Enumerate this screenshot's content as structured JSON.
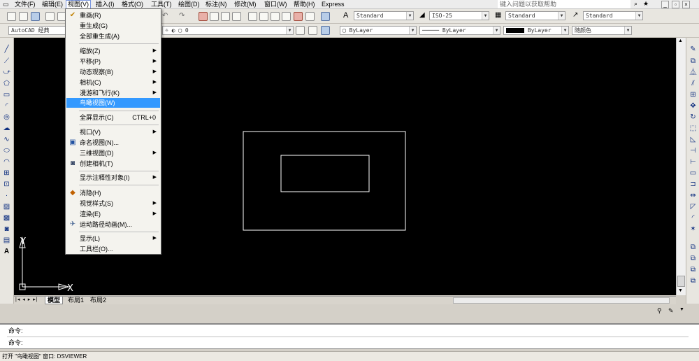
{
  "menubar": {
    "items": [
      "文件(F)",
      "编辑(E)",
      "视图(V)",
      "插入(I)",
      "格式(O)",
      "工具(T)",
      "绘图(D)",
      "标注(N)",
      "修改(M)",
      "窗口(W)",
      "帮助(H)",
      "Express"
    ],
    "help_placeholder": "键入问题以获取帮助"
  },
  "toolbar1": {
    "text_style": "Standard",
    "dim_style": "ISO-25",
    "table_style": "Standard",
    "multileader_style": "Standard"
  },
  "toolbar2": {
    "workspace": "AutoCAD 经典",
    "layer": "0",
    "color": "ByLayer",
    "linetype": "ByLayer",
    "lineweight": "ByLayer",
    "plotstyle": "随颜色"
  },
  "view_menu": {
    "items": [
      {
        "label": "重画(R)",
        "icon": "redraw-icon"
      },
      {
        "label": "重生成(G)"
      },
      {
        "label": "全部重生成(A)"
      },
      {
        "label": "缩放(Z)",
        "submenu": true
      },
      {
        "label": "平移(P)",
        "submenu": true
      },
      {
        "label": "动态观察(B)",
        "submenu": true
      },
      {
        "label": "相机(C)",
        "submenu": true
      },
      {
        "label": "漫游和飞行(K)",
        "submenu": true
      },
      {
        "label": "鸟瞰视图(W)",
        "highlighted": true
      },
      {
        "label": "全屏显示(C)",
        "shortcut": "CTRL+0"
      },
      {
        "label": "视口(V)",
        "submenu": true
      },
      {
        "label": "命名视图(N)...",
        "icon": "named-view-icon"
      },
      {
        "label": "三维视图(D)",
        "submenu": true
      },
      {
        "label": "创建相机(T)",
        "icon": "camera-icon"
      },
      {
        "label": "显示注释性对象(I)",
        "submenu": true
      },
      {
        "label": "消隐(H)",
        "icon": "hide-icon"
      },
      {
        "label": "视觉样式(S)",
        "submenu": true
      },
      {
        "label": "渲染(E)",
        "submenu": true
      },
      {
        "label": "运动路径动画(M)...",
        "icon": "motion-path-icon"
      },
      {
        "label": "显示(L)",
        "submenu": true
      },
      {
        "label": "工具栏(O)..."
      }
    ]
  },
  "ucs": {
    "x_label": "X",
    "y_label": "Y"
  },
  "tabs": [
    "模型",
    "布局1",
    "布局2"
  ],
  "command": {
    "line1": "命令:",
    "line2": "命令:"
  },
  "status_text": "打开 \"鸟瞰视图\" 窗口:  DSVIEWER",
  "colors": {
    "highlight": "#3399ff",
    "canvas": "#000000"
  }
}
